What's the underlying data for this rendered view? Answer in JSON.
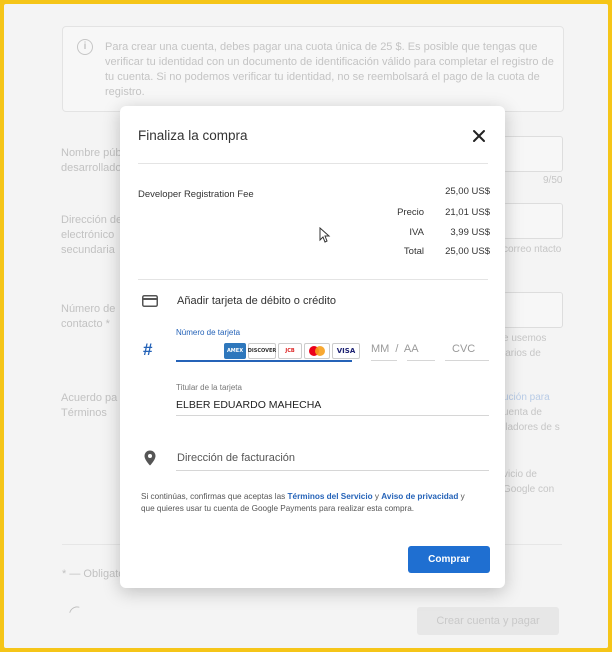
{
  "background": {
    "info_text": "Para crear una cuenta, debes pagar una cuota única de 25 $. Es posible que tengas que verificar tu identidad con un documento de identificación válido para completar el registro de tu cuenta. Si no podemos verificar tu identidad, no se reembolsará el pago de la cuota de registro.",
    "label_public_name": "Nombre púb desarrollado",
    "counter": "9/50",
    "label_email": "Dirección de electrónico secundaria",
    "hint_email": "correo ntacto",
    "label_phone": "Número de contacto *",
    "hint_phone": "e usemos iarios de",
    "label_agreement": "Acuerdo pa y Términos",
    "agreement_link": "ución para",
    "agreement_text": "uenta de lladores de s",
    "agreement_text2": "vicio de Google con",
    "required_note": "* — Obligato",
    "create_button": "Crear cuenta y pagar"
  },
  "dialog": {
    "title": "Finaliza la compra",
    "item_name": "Developer Registration Fee",
    "item_total": "25,00 US$",
    "price_label": "Precio",
    "price_value": "21,01 US$",
    "tax_label": "IVA",
    "tax_value": "3,99 US$",
    "total_label": "Total",
    "total_value": "25,00 US$",
    "add_card_label": "Añadir tarjeta de débito o crédito",
    "card_number_label": "Número de tarjeta",
    "card_brands": [
      "AMEX",
      "DISCOVER",
      "JCB",
      "MasterCard",
      "VISA"
    ],
    "expiry_mm": "MM",
    "expiry_sep": "/",
    "expiry_aa": "AA",
    "cvc": "CVC",
    "holder_label": "Titular de la tarjeta",
    "holder_value": "ELBER EDUARDO MAHECHA",
    "billing_label": "Dirección de facturación",
    "legal_prefix": "Si continúas, confirmas que aceptas las ",
    "legal_terms": "Términos del Servicio",
    "legal_and": " y ",
    "legal_privacy": "Aviso de privacidad",
    "legal_suffix": " y que quieres usar tu cuenta de Google Payments para realizar esta compra.",
    "buy_button": "Comprar"
  },
  "colors": {
    "accent": "#1f6fd1",
    "frame": "#f5c518"
  }
}
